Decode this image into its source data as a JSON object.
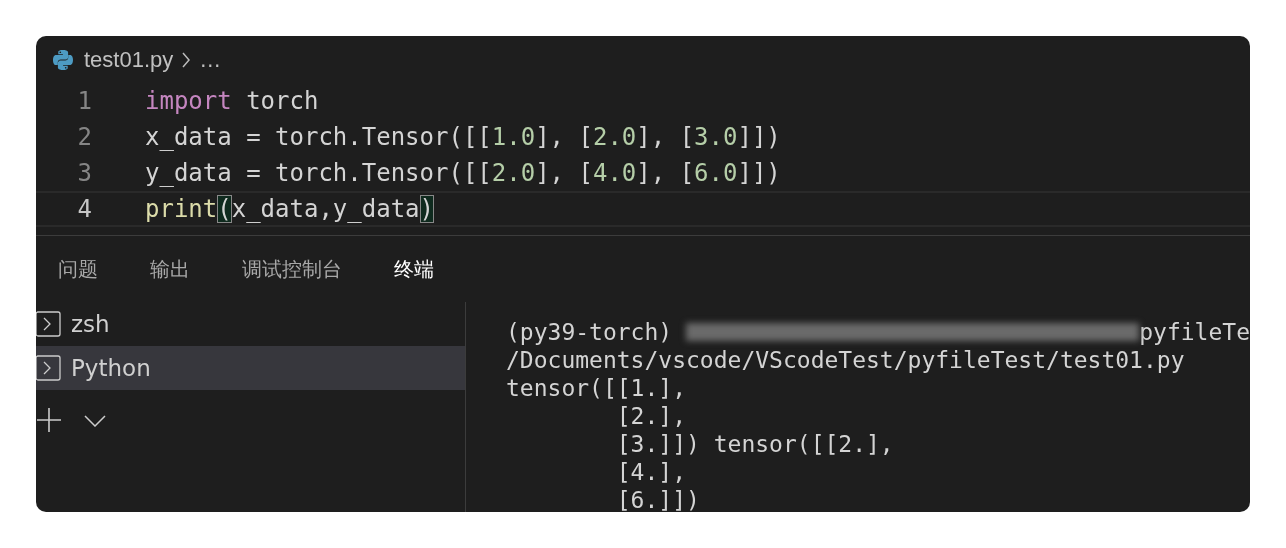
{
  "editor": {
    "breadcrumb": {
      "file": "test01.py",
      "more": "…"
    },
    "lines": [
      {
        "number": "1",
        "current": false,
        "tokens": [
          {
            "kind": "keyword",
            "text": "import"
          },
          {
            "kind": "plain",
            "text": " torch"
          }
        ]
      },
      {
        "number": "2",
        "current": false,
        "tokens": [
          {
            "kind": "plain",
            "text": "x_data = torch.Tensor([["
          },
          {
            "kind": "number",
            "text": "1.0"
          },
          {
            "kind": "plain",
            "text": "], ["
          },
          {
            "kind": "number",
            "text": "2.0"
          },
          {
            "kind": "plain",
            "text": "], ["
          },
          {
            "kind": "number",
            "text": "3.0"
          },
          {
            "kind": "plain",
            "text": "]])"
          }
        ]
      },
      {
        "number": "3",
        "current": false,
        "tokens": [
          {
            "kind": "plain",
            "text": "y_data = torch.Tensor([["
          },
          {
            "kind": "number",
            "text": "2.0"
          },
          {
            "kind": "plain",
            "text": "], ["
          },
          {
            "kind": "number",
            "text": "4.0"
          },
          {
            "kind": "plain",
            "text": "], ["
          },
          {
            "kind": "number",
            "text": "6.0"
          },
          {
            "kind": "plain",
            "text": "]])"
          }
        ]
      },
      {
        "number": "4",
        "current": true,
        "tokens": [
          {
            "kind": "function",
            "text": "print"
          },
          {
            "kind": "bracket",
            "text": "("
          },
          {
            "kind": "plain",
            "text": "x_data,y_data"
          },
          {
            "kind": "bracket",
            "text": ")"
          }
        ]
      }
    ]
  },
  "panel": {
    "tabs": [
      {
        "label": "问题",
        "selected": false
      },
      {
        "label": "输出",
        "selected": false
      },
      {
        "label": "调试控制台",
        "selected": false
      },
      {
        "label": "终端",
        "selected": true
      }
    ],
    "terminals": [
      {
        "name": "zsh",
        "selected": false
      },
      {
        "name": "Python",
        "selected": true
      }
    ],
    "output": [
      {
        "segments": [
          {
            "kind": "text",
            "text": "(py39-torch) "
          },
          {
            "kind": "redacted"
          },
          {
            "kind": "text",
            "text": "pyfileTe"
          }
        ]
      },
      {
        "segments": [
          {
            "kind": "text",
            "text": "/Documents/vscode/VScodeTest/pyfileTest/test01.py"
          }
        ]
      },
      {
        "segments": [
          {
            "kind": "text",
            "text": "tensor([[1.],"
          }
        ]
      },
      {
        "segments": [
          {
            "kind": "text",
            "text": "        [2.],"
          }
        ]
      },
      {
        "segments": [
          {
            "kind": "text",
            "text": "        [3.]]) tensor([[2.],"
          }
        ]
      },
      {
        "segments": [
          {
            "kind": "text",
            "text": "        [4.],"
          }
        ]
      },
      {
        "segments": [
          {
            "kind": "text",
            "text": "        [6.]])"
          }
        ]
      }
    ]
  }
}
